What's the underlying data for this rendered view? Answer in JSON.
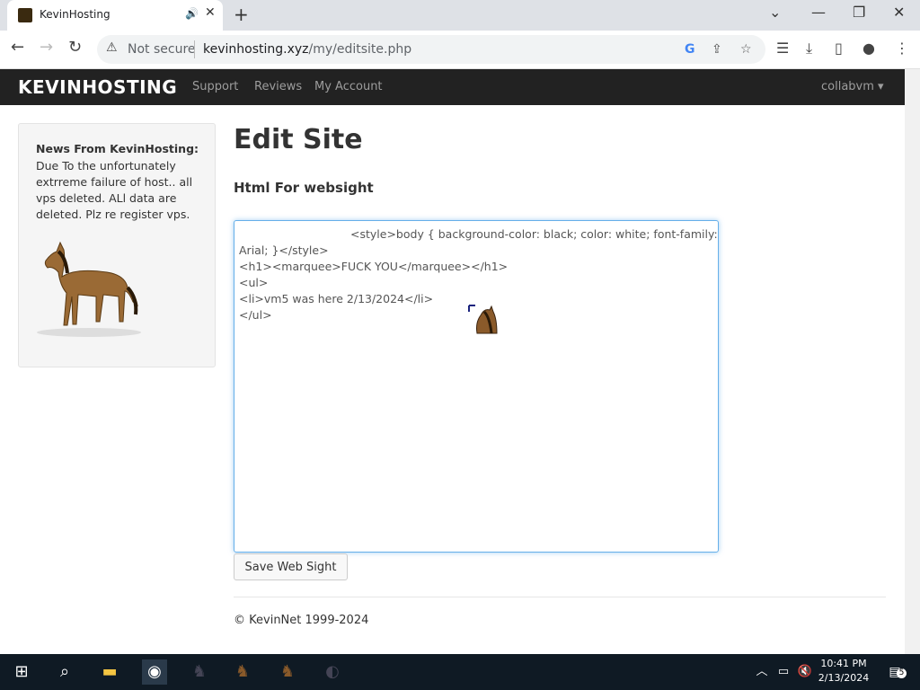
{
  "browser": {
    "tab_title": "KevinHosting",
    "security_label": "Not secure",
    "url_domain": "kevinhosting.xyz",
    "url_path": "/my/editsite.php"
  },
  "navbar": {
    "brand": "KEVINHOSTING",
    "links": [
      "Support",
      "Reviews",
      "My Account"
    ],
    "user": "collabvm ▾"
  },
  "sidebar": {
    "news_title": "News From KevinHosting:",
    "news_body": "Due To the unfortunately extrreme failure of host.. all vps deleted. ALl data are deleted. Plz re register vps."
  },
  "main": {
    "title": "Edit Site",
    "subtitle": "Html For websight",
    "editor_lines": [
      "<style>body { background-color: black; color: white; font-family:",
      "Arial; }</style>",
      "<h1><marquee>FUCK YOU</marquee></h1>",
      "<ul>",
      "<li>vm5 was here 2/13/2024</li>",
      "</ul>"
    ],
    "save_label": "Save Web Sight",
    "footer": "© KevinNet 1999-2024"
  },
  "taskbar": {
    "time": "10:41 PM",
    "date": "2/13/2024",
    "notifications": "5"
  }
}
